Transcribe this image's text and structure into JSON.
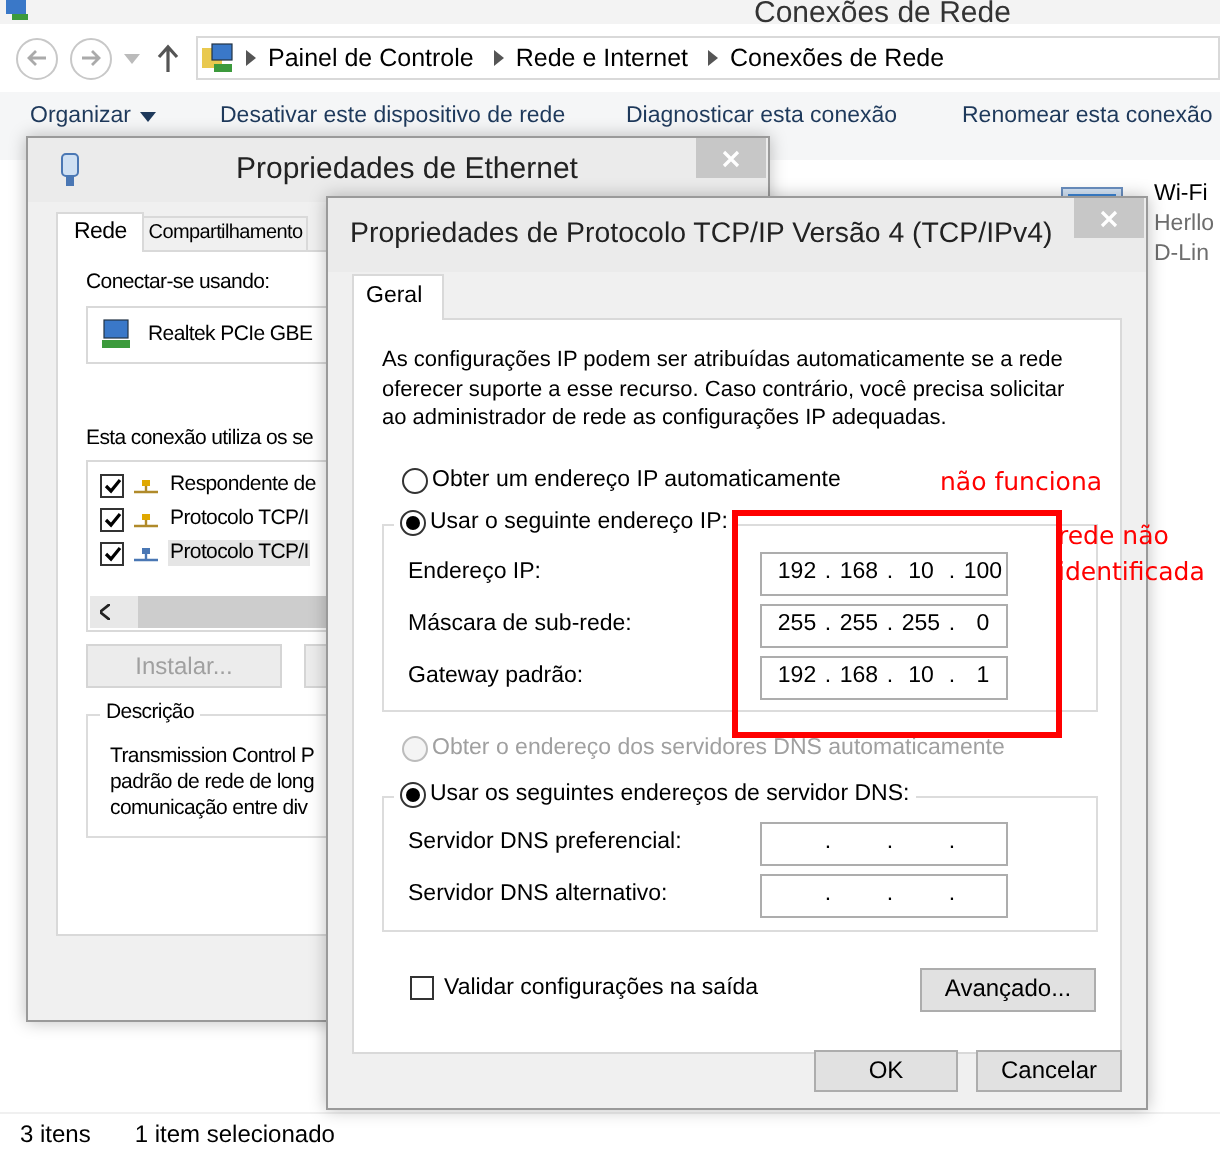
{
  "explorer": {
    "title": "Conexões de Rede",
    "breadcrumb": [
      "Painel de Controle",
      "Rede e Internet",
      "Conexões de Rede"
    ],
    "toolbar": [
      {
        "label": "Organizar",
        "dropdown": true
      },
      {
        "label": "Desativar este dispositivo de rede",
        "dropdown": false
      },
      {
        "label": "Diagnosticar esta conexão",
        "dropdown": false
      },
      {
        "label": "Renomear esta conexão",
        "dropdown": false
      }
    ],
    "connections": [
      {
        "name": "Wi-Fi",
        "lines": [
          "Herllo",
          "D-Lin"
        ]
      }
    ],
    "status_bar": [
      "3 itens",
      "1 item selecionado"
    ]
  },
  "ethernet": {
    "title": "Propriedades de Ethernet",
    "tabs": [
      {
        "label": "Rede",
        "selected": true
      },
      {
        "label": "Compartilhamento",
        "selected": false
      }
    ],
    "connect_label": "Conectar-se usando:",
    "adapter": "Realtek PCIe GBE",
    "items_label": "Esta conexão utiliza os se",
    "items": [
      {
        "label": "Respondente de",
        "checked": true,
        "selected": false
      },
      {
        "label": "Protocolo TCP/I",
        "checked": true,
        "selected": false
      },
      {
        "label": "Protocolo TCP/I",
        "checked": true,
        "selected": true
      }
    ],
    "buttons": [
      {
        "label": "Instalar...",
        "disabled": true
      }
    ],
    "description": {
      "title": "Descrição",
      "lines": [
        "Transmission Control P",
        "padrão de rede de long",
        "comunicação entre div"
      ]
    }
  },
  "tcp": {
    "title": "Propriedades de Protocolo TCP/IP Versão 4 (TCP/IPv4)",
    "tabs": [
      {
        "label": "Geral",
        "selected": true
      }
    ],
    "intro": "As configurações IP podem ser atribuídas automaticamente se a rede oferecer suporte a esse recurso. Caso contrário, você precisa solicitar ao administrador de rede as configurações IP adequadas.",
    "ip_mode": [
      {
        "label": "Obter um endereço IP automaticamente",
        "selected": false,
        "disabled": false
      },
      {
        "label": "Usar o seguinte endereço IP:",
        "selected": true,
        "disabled": false
      }
    ],
    "ip_fields": [
      {
        "label": "Endereço IP:",
        "parts": [
          "192",
          ".",
          "168",
          ".",
          "10",
          ".",
          "100"
        ]
      },
      {
        "label": "Máscara de sub-rede:",
        "parts": [
          "255",
          ".",
          "255",
          ".",
          "255",
          ".",
          "0"
        ]
      },
      {
        "label": "Gateway padrão:",
        "parts": [
          "192",
          ".",
          "168",
          ".",
          "10",
          ".",
          "1"
        ]
      }
    ],
    "dns_mode": [
      {
        "label": "Obter o endereço dos servidores DNS automaticamente",
        "selected": false,
        "disabled": true
      },
      {
        "label": "Usar os seguintes endereços de servidor DNS:",
        "selected": true,
        "disabled": false
      }
    ],
    "dns_fields": [
      {
        "label": "Servidor DNS preferencial:",
        "parts": [
          ".",
          ".",
          "."
        ]
      },
      {
        "label": "Servidor DNS alternativo:",
        "parts": [
          ".",
          ".",
          "."
        ]
      }
    ],
    "validate": {
      "label": "Validar configurações na saída",
      "checked": false
    },
    "advanced_button": "Avançado...",
    "buttons": [
      "OK",
      "Cancelar"
    ]
  },
  "annotations": [
    {
      "kind": "note",
      "text": "não funciona"
    },
    {
      "kind": "box"
    },
    {
      "kind": "note",
      "text": "rede não identificada"
    }
  ]
}
